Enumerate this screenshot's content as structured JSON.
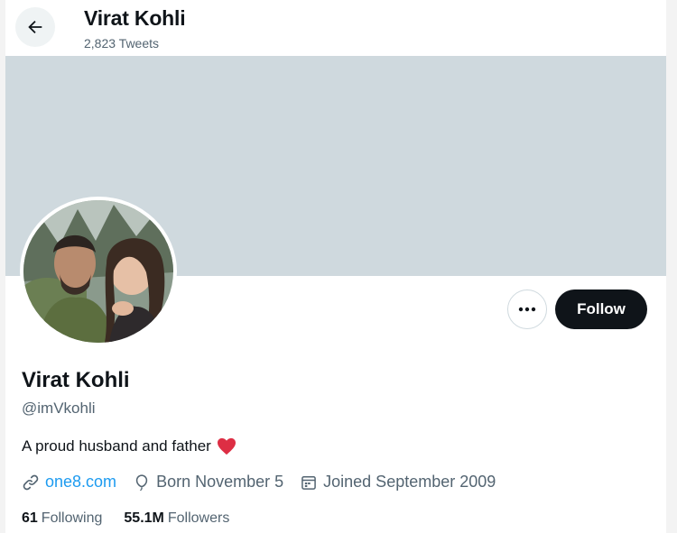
{
  "header": {
    "title": "Virat Kohli",
    "tweet_count": "2,823 Tweets"
  },
  "profile": {
    "name": "Virat Kohli",
    "handle": "@imVkohli",
    "bio": "A proud husband and father",
    "bio_emoji": "heart-emoji"
  },
  "actions": {
    "follow_label": "Follow",
    "more_icon": "more-icon"
  },
  "meta": {
    "website": "one8.com",
    "birthday": "Born November 5",
    "joined": "Joined September 2009"
  },
  "stats": {
    "following_count": "61",
    "following_label": "Following",
    "followers_count": "55.1M",
    "followers_label": "Followers"
  },
  "colors": {
    "banner": "#cfd9de",
    "link": "#1d9bf0",
    "button": "#0f1419",
    "heart": "#e0245e"
  }
}
